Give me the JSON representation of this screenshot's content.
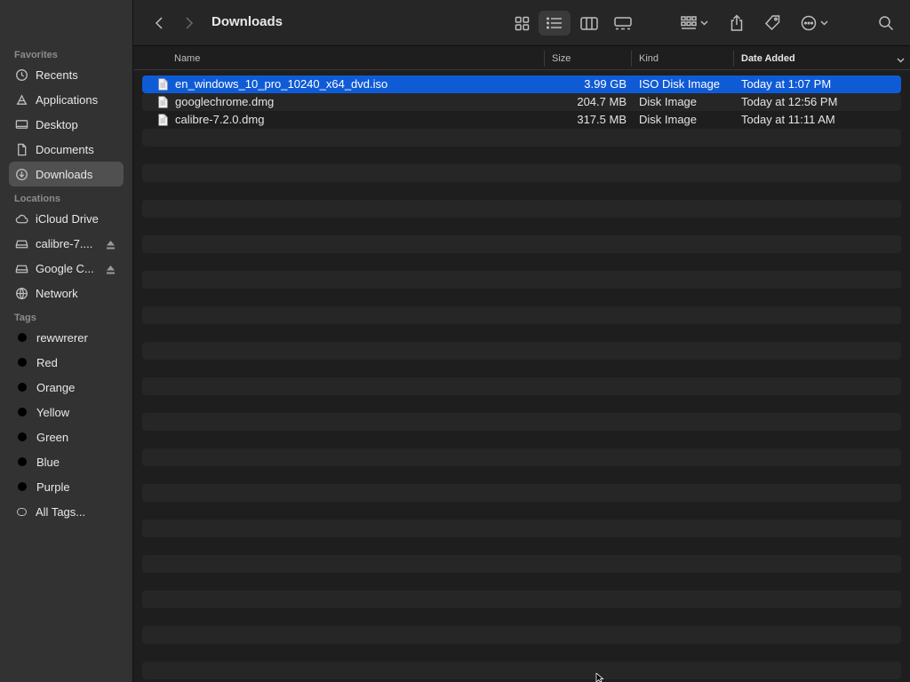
{
  "window": {
    "title": "Downloads"
  },
  "sidebar": {
    "sections": [
      {
        "label": "Favorites"
      },
      {
        "label": "Locations"
      },
      {
        "label": "Tags"
      }
    ],
    "favorites": [
      {
        "label": "Recents",
        "icon": "clock-icon"
      },
      {
        "label": "Applications",
        "icon": "applications-icon"
      },
      {
        "label": "Desktop",
        "icon": "desktop-icon"
      },
      {
        "label": "Documents",
        "icon": "document-icon"
      },
      {
        "label": "Downloads",
        "icon": "download-icon",
        "active": true
      }
    ],
    "locations": [
      {
        "label": "iCloud Drive",
        "icon": "cloud-icon"
      },
      {
        "label": "calibre-7....",
        "icon": "drive-icon",
        "eject": true
      },
      {
        "label": "Google C...",
        "icon": "drive-icon",
        "eject": true
      },
      {
        "label": "Network",
        "icon": "globe-icon"
      }
    ],
    "tags": [
      {
        "label": "rewwrerer"
      },
      {
        "label": "Red"
      },
      {
        "label": "Orange"
      },
      {
        "label": "Yellow"
      },
      {
        "label": "Green"
      },
      {
        "label": "Blue"
      },
      {
        "label": "Purple"
      },
      {
        "label": "All Tags..."
      }
    ]
  },
  "columns": {
    "name": "Name",
    "size": "Size",
    "kind": "Kind",
    "date_added": "Date Added"
  },
  "files": [
    {
      "name": "en_windows_10_pro_10240_x64_dvd.iso",
      "size": "3.99 GB",
      "kind": "ISO Disk Image",
      "date_added": "Today at 1:07 PM",
      "selected": true
    },
    {
      "name": "googlechrome.dmg",
      "size": "204.7 MB",
      "kind": "Disk Image",
      "date_added": "Today at 12:56 PM"
    },
    {
      "name": "calibre-7.2.0.dmg",
      "size": "317.5 MB",
      "kind": "Disk Image",
      "date_added": "Today at 11:11 AM"
    }
  ],
  "colors": {
    "selection": "#0f5bd6",
    "sidebar_bg": "#323232",
    "content_bg": "#1e1e1e",
    "stripe": "#262626"
  }
}
